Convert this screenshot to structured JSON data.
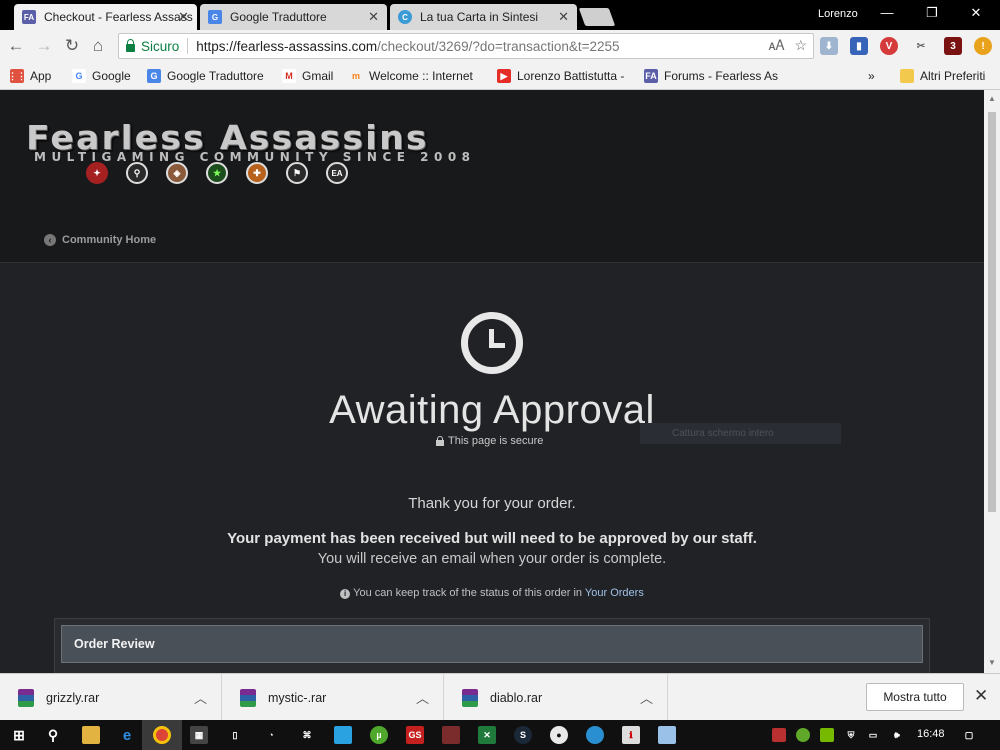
{
  "browser": {
    "tabs": [
      {
        "title": "Checkout - Fearless Assass",
        "favicon": "FA",
        "active": true
      },
      {
        "title": "Google Traduttore",
        "favicon": "G",
        "active": false
      },
      {
        "title": "La tua Carta in Sintesi",
        "favicon": "C",
        "active": false
      }
    ],
    "profile": "Lorenzo",
    "secure_label": "Sicuro",
    "url_host": "https://fearless-assassins.com",
    "url_path": "/checkout/3269/?do=transaction&t=2255",
    "extension_badge": "3",
    "bookmarks": [
      {
        "label": "App",
        "icon": "apps-grid-icon"
      },
      {
        "label": "Google",
        "icon": "google-icon"
      },
      {
        "label": "Google Traduttore",
        "icon": "translate-icon"
      },
      {
        "label": "Gmail",
        "icon": "gmail-icon"
      },
      {
        "label": "Welcome :: Internet",
        "icon": "moodle-icon"
      },
      {
        "label": "Lorenzo Battistutta -",
        "icon": "youtube-icon"
      },
      {
        "label": "Forums - Fearless As",
        "icon": "fa-icon"
      }
    ],
    "bookmarks_overflow": "»",
    "other_bookmarks": "Altri Preferiti"
  },
  "site": {
    "logo_title": "Fearless Assassins",
    "logo_subtitle": "MULTIGAMING COMMUNITY SINCE 2008",
    "nav_home": "Community Home"
  },
  "checkout": {
    "status_title": "Awaiting Approval",
    "secure_note": "This page is secure",
    "capture_hint": "Cattura schermo intero",
    "thanks": "Thank you for your order.",
    "received": "Your payment has been received but will need to be approved by our staff.",
    "email_note": "You will receive an email when your order is complete.",
    "track_prefix": "You can keep track of the status of this order in",
    "track_link": "Your Orders",
    "review_title": "Order Review"
  },
  "downloads": {
    "files": [
      "grizzly.rar",
      "mystic-.rar",
      "diablo.rar"
    ],
    "show_all": "Mostra tutto"
  },
  "taskbar": {
    "time": "16:48"
  },
  "colors": {
    "secure_green": "#0b8043",
    "link_blue": "#9fc0e8",
    "page_bg": "#212226",
    "header_bg": "#18191b"
  }
}
